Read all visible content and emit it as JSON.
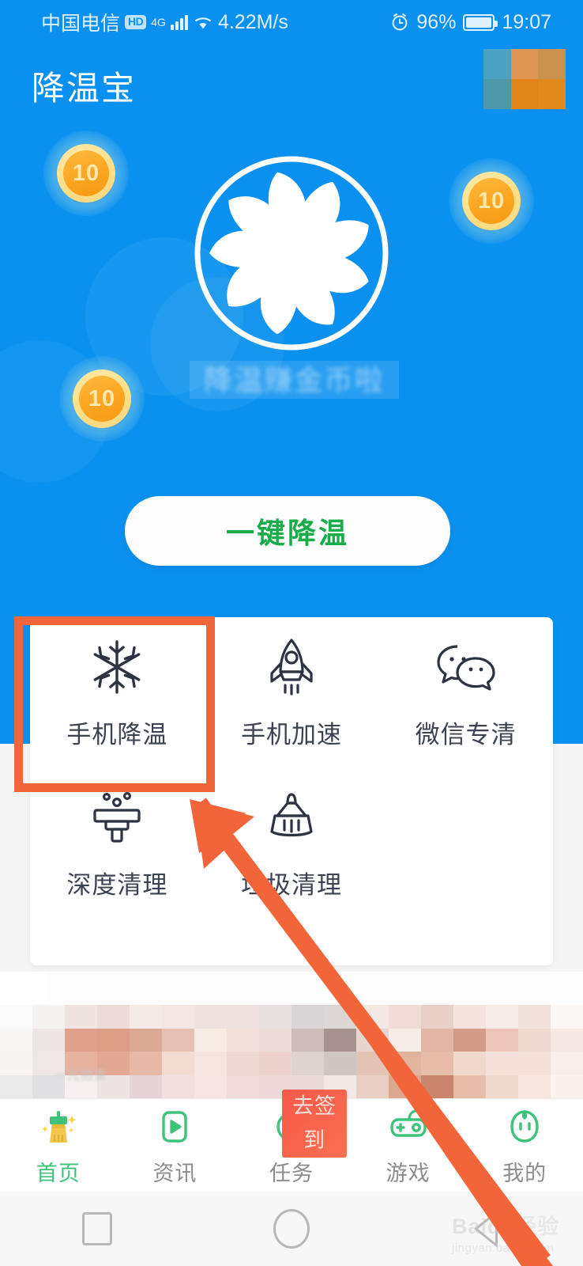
{
  "status_bar": {
    "carrier": "中国电信",
    "hd_badge": "HD",
    "network": "4G",
    "speed": "4.22M/s",
    "battery_percent": "96%",
    "time": "19:07",
    "icons": [
      "signal-bars-icon",
      "wifi-icon",
      "alarm-icon",
      "battery-icon"
    ]
  },
  "header": {
    "app_title": "降温宝",
    "badge": "mosaic-badge"
  },
  "hero": {
    "fan_icon": "fan-icon",
    "coins": [
      {
        "value": "10"
      },
      {
        "value": "10"
      },
      {
        "value": "10"
      }
    ],
    "blurred_banner_text": "降温赚金币啦",
    "main_button": "一键降温"
  },
  "features": {
    "items": [
      {
        "label": "手机降温",
        "icon": "snowflake-icon",
        "highlighted": true
      },
      {
        "label": "手机加速",
        "icon": "rocket-icon",
        "highlighted": false
      },
      {
        "label": "微信专清",
        "icon": "wechat-icon",
        "highlighted": false
      },
      {
        "label": "深度清理",
        "icon": "deep-clean-icon",
        "highlighted": false
      },
      {
        "label": "垃圾清理",
        "icon": "broom-icon",
        "highlighted": false
      }
    ]
  },
  "annotation": {
    "highlight_color": "#f2653a",
    "arrow": "orange-arrow-pointing-to-phone-cooling"
  },
  "ad": {
    "blurred_caption": "一元拍卖"
  },
  "tabbar": {
    "items": [
      {
        "label": "首页",
        "icon": "broom-tab-icon",
        "active": true
      },
      {
        "label": "资讯",
        "icon": "play-tab-icon",
        "active": false
      },
      {
        "label": "任务",
        "icon": "clock-tab-icon",
        "active": false,
        "badge": "去签\n到"
      },
      {
        "label": "游戏",
        "icon": "gamepad-tab-icon",
        "active": false
      },
      {
        "label": "我的",
        "icon": "face-tab-icon",
        "active": false
      }
    ],
    "badge_line1": "去签",
    "badge_line2": "到",
    "active_color": "#3fc37a"
  },
  "navbar": {
    "buttons": [
      "recents-square-icon",
      "home-circle-icon",
      "back-triangle-icon"
    ]
  },
  "watermark": {
    "main": "Baidu",
    "main_suffix": "经验",
    "sub": "jingyan.baidu.com"
  },
  "colors": {
    "hero_blue": "#0a91ef",
    "accent_green": "#1aab4b",
    "annotation_orange": "#f2653a",
    "coin_orange": "#fba41f"
  }
}
